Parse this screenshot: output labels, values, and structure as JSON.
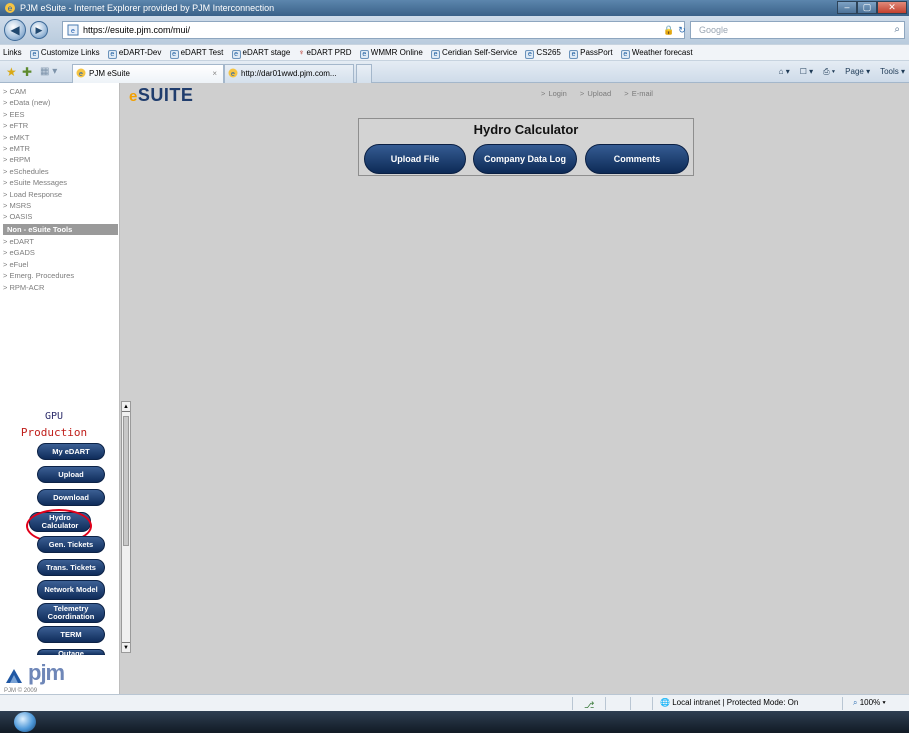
{
  "window": {
    "title": "PJM eSuite - Internet Explorer provided by PJM Interconnection",
    "buttons": {
      "minimize": "–",
      "maximize": "▢",
      "close": "✕"
    }
  },
  "address_bar": {
    "back": "◀",
    "forward": "▶",
    "url": "https://esuite.pjm.com/mui/",
    "lock": "🔒",
    "refresh": "↻",
    "stop": "✕",
    "search_placeholder": "Google",
    "search_icon": "⌕"
  },
  "links_bar": {
    "label": "Links",
    "items": [
      "Customize Links",
      "eDART-Dev",
      "eDART Test",
      "eDART stage",
      "eDART PRD",
      "WMMR Online",
      "Ceridian Self-Service",
      "CS265",
      "PassPort",
      "Weather forecast"
    ]
  },
  "tabs": {
    "tab1_label": "PJM eSuite",
    "tab1_close": "×",
    "tab2_label": "http://dar01wwd.pjm.com...",
    "commands": [
      "Page ▾",
      "Tools ▾"
    ],
    "cmd_icons": [
      "⌂ ▾",
      "☐ ▾",
      "⎙ ▾"
    ]
  },
  "left_menu": {
    "items_top": [
      "> CAM",
      "> eData (new)",
      "> EES",
      "> eFTR",
      "> eMKT",
      "> eMTR",
      "> eRPM",
      "> eSchedules",
      "> eSuite Messages",
      "> Load Response",
      "> MSRS",
      "> OASIS"
    ],
    "header": "Non - eSuite Tools",
    "items_bottom": [
      "> eDART",
      "> eGADS",
      "> eFuel",
      "> Emerg. Procedures",
      "> RPM-ACR"
    ]
  },
  "gpu_panel": {
    "title": "GPU",
    "subtitle": "Production",
    "buttons": [
      "My eDART",
      "Upload",
      "Download",
      "Hydro Calculator",
      "Gen. Tickets",
      "Trans. Tickets",
      "Network Model",
      "Telemetry Coordination",
      "TERM",
      "Outage"
    ]
  },
  "scrollbar": {
    "up": "▲",
    "down": "▼"
  },
  "pjm_logo": {
    "text": "pjm",
    "copyright": "PJM © 2009"
  },
  "header": {
    "logo_e": "e",
    "logo_suite": "SUITE",
    "links": [
      "> Login",
      "> Upload",
      "> E-mail"
    ]
  },
  "hydro": {
    "title": "Hydro Calculator",
    "buttons": [
      "Upload File",
      "Company Data Log",
      "Comments"
    ]
  },
  "status_bar": {
    "zone_icon": "🌐",
    "zone": "Local intranet | Protected Mode: On",
    "zoom": "100%"
  }
}
